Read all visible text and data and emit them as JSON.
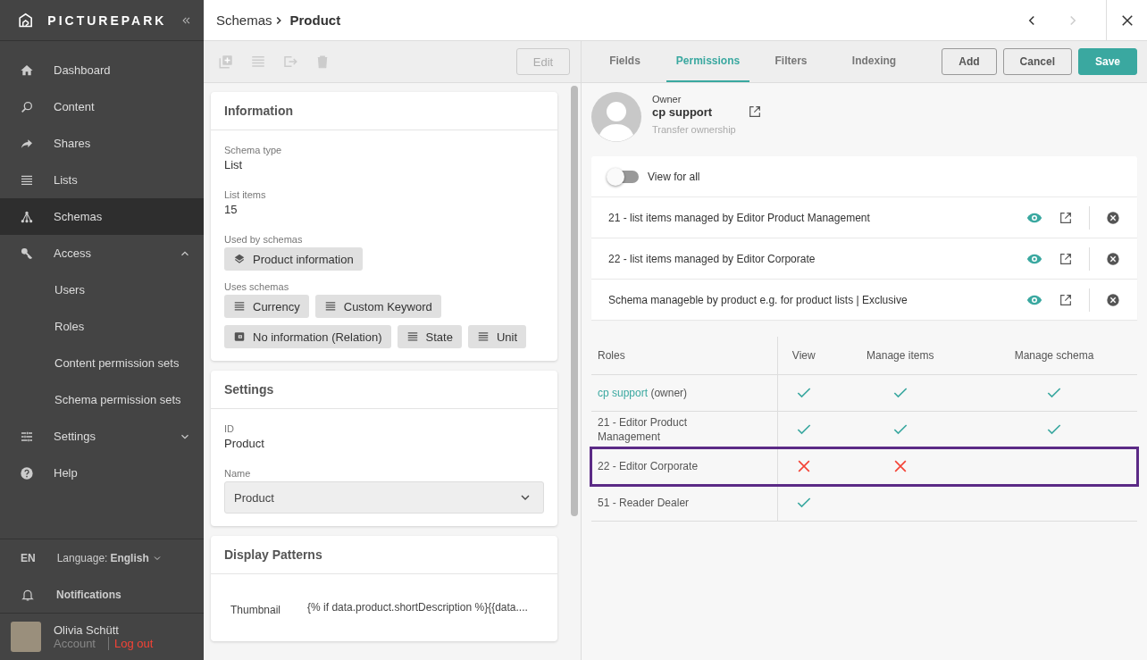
{
  "header": {
    "breadcrumb": "Schemas",
    "title": "Product",
    "previous_disabled": false,
    "next_disabled": true
  },
  "sidebar": {
    "brand": "PICTUREPARK",
    "items": [
      {
        "label": "Dashboard",
        "selected": false
      },
      {
        "label": "Content",
        "selected": false
      },
      {
        "label": "Shares",
        "selected": false
      },
      {
        "label": "Lists",
        "selected": false
      },
      {
        "label": "Schemas",
        "selected": true
      },
      {
        "label": "Access",
        "selected": false,
        "expanded": true,
        "children": [
          {
            "label": "Users",
            "selected": false
          },
          {
            "label": "Roles",
            "selected": false
          },
          {
            "label": "Content permission sets",
            "selected": false
          },
          {
            "label": "Schema permission sets",
            "selected": false
          }
        ]
      },
      {
        "label": "Settings",
        "selected": false,
        "expanded": false
      },
      {
        "label": "Help",
        "selected": false
      }
    ],
    "language": {
      "code": "EN",
      "label": "Language:",
      "value": "English"
    },
    "notifications": "Notifications",
    "user": {
      "name": "Olivia Schütt",
      "account": "Account",
      "logout": "Log out"
    }
  },
  "detail": {
    "edit_button": {
      "label": "Edit",
      "disabled": true
    },
    "information": {
      "title": "Information",
      "fields": [
        {
          "label": "Schema type",
          "value": "List"
        },
        {
          "label": "List items",
          "value": "15"
        }
      ],
      "used_by": {
        "label": "Used by schemas",
        "chips": [
          {
            "label": "Product information"
          }
        ]
      },
      "uses": {
        "label": "Uses schemas",
        "chips": [
          {
            "label": "Currency",
            "kind": "list"
          },
          {
            "label": "Custom Keyword",
            "kind": "list"
          },
          {
            "label": "No information (Relation)",
            "kind": "relation"
          },
          {
            "label": "State",
            "kind": "list"
          },
          {
            "label": "Unit",
            "kind": "list"
          }
        ]
      }
    },
    "settings": {
      "title": "Settings",
      "id_label": "ID",
      "id_value": "Product",
      "name_label": "Name",
      "name_value": "Product"
    },
    "display_patterns": {
      "title": "Display Patterns",
      "rows": [
        {
          "label": "Thumbnail",
          "value": "{% if data.product.shortDescription %}{{data...."
        }
      ]
    }
  },
  "permissions": {
    "tabs": [
      {
        "label": "Fields",
        "selected": false
      },
      {
        "label": "Permissions",
        "selected": true
      },
      {
        "label": "Filters",
        "selected": false
      },
      {
        "label": "Indexing",
        "selected": false
      }
    ],
    "actions": [
      {
        "label": "Add",
        "kind": "outline"
      },
      {
        "label": "Cancel",
        "kind": "outline"
      },
      {
        "label": "Save",
        "kind": "primary"
      }
    ],
    "owner": {
      "caption": "Owner",
      "name": "cp support",
      "transfer": "Transfer ownership"
    },
    "view_for_all": {
      "label": "View for all",
      "on": false
    },
    "permission_sets": [
      {
        "label": "21 - list items managed by Editor Product Management"
      },
      {
        "label": "22 - list items managed by Editor Corporate"
      },
      {
        "label": "Schema manageble by product e.g. for product lists | Exclusive"
      }
    ],
    "roles_table": {
      "columns": [
        "Roles",
        "View",
        "Manage items",
        "Manage schema"
      ],
      "rows": [
        {
          "role": "cp support",
          "note": "(owner)",
          "is_link": true,
          "highlighted": false,
          "cells": [
            {
              "kind": "check"
            },
            {
              "kind": "check"
            },
            {
              "kind": "check"
            }
          ]
        },
        {
          "role": "21 - Editor Product Management",
          "is_link": false,
          "highlighted": false,
          "cells": [
            {
              "kind": "check"
            },
            {
              "kind": "check"
            },
            {
              "kind": "check"
            }
          ]
        },
        {
          "role": "22 - Editor Corporate",
          "is_link": false,
          "highlighted": true,
          "cells": [
            {
              "kind": "cross"
            },
            {
              "kind": "cross"
            },
            {
              "kind": "empty"
            }
          ]
        },
        {
          "role": "51 - Reader Dealer",
          "is_link": false,
          "highlighted": false,
          "cells": [
            {
              "kind": "check"
            },
            {
              "kind": "empty"
            },
            {
              "kind": "empty"
            }
          ]
        }
      ]
    }
  }
}
